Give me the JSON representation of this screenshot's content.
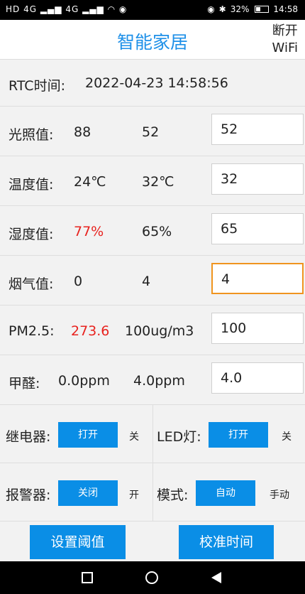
{
  "status": {
    "left_icons": "HD 4G ▂▄▆ 4G ▂▄▆ ◠ ◉",
    "battery": "32%",
    "time": "14:58"
  },
  "header": {
    "title": "智能家居",
    "disconnect_line1": "断开",
    "disconnect_line2": "WiFi"
  },
  "rtc": {
    "label": "RTC时间:",
    "value": "2022-04-23 14:58:56"
  },
  "sensors": [
    {
      "label": "光照值:",
      "current": "88",
      "threshold": "52",
      "input": "52"
    },
    {
      "label": "温度值:",
      "current": "24℃",
      "threshold": "32℃",
      "input": "32"
    },
    {
      "label": "湿度值:",
      "current": "77%",
      "threshold": "65%",
      "input": "65"
    },
    {
      "label": "烟气值:",
      "current": "0",
      "threshold": "4",
      "input": "4"
    },
    {
      "label": "PM2.5:",
      "current": "273.6",
      "threshold": "100ug/m3",
      "input": "100"
    },
    {
      "label": "甲醛:",
      "current": "0.0ppm",
      "threshold": "4.0ppm",
      "input": "4.0"
    }
  ],
  "controls": {
    "relay": {
      "label": "继电器:",
      "button": "打开",
      "alt": "关"
    },
    "led": {
      "label": "LED灯:",
      "button": "打开",
      "alt": "关"
    },
    "alarm": {
      "label": "报警器:",
      "button": "关闭",
      "alt": "开"
    },
    "mode": {
      "label": "模式:",
      "button": "自动",
      "alt": "手动"
    }
  },
  "actions": {
    "set_threshold": "设置阈值",
    "calibrate_time": "校准时间"
  },
  "colors": {
    "accent": "#1e90e8",
    "button": "#0a8ee6",
    "alert": "#e8221e",
    "focus": "#f0941f"
  }
}
